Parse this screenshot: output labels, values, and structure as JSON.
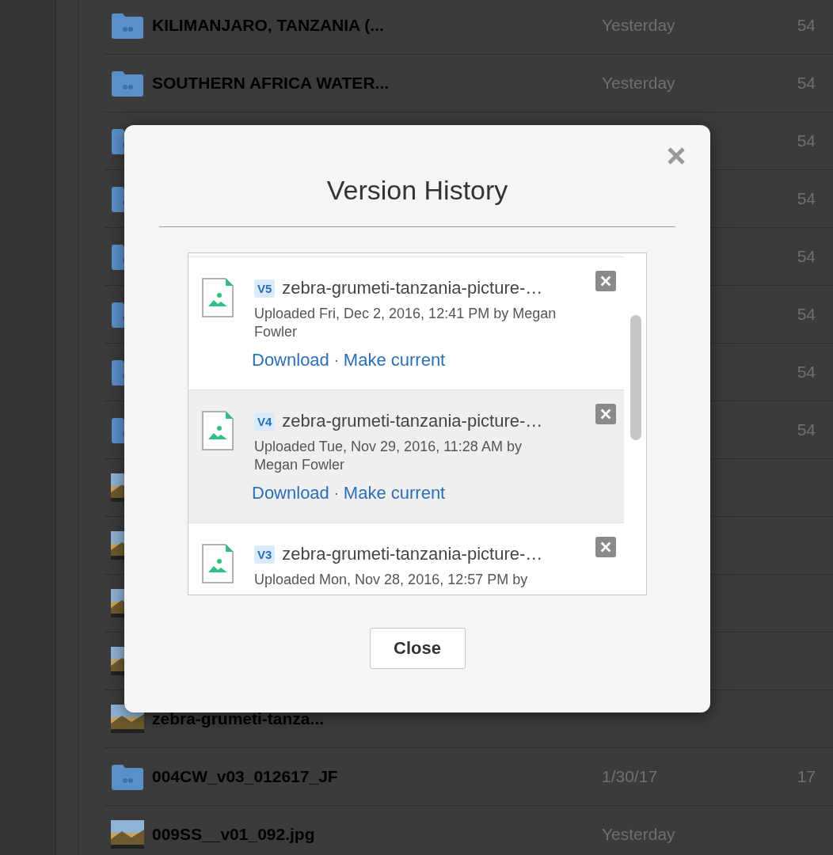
{
  "file_list": {
    "rows": [
      {
        "kind": "folder",
        "name": "KILIMANJARO, TANZANIA (...",
        "date": "Yesterday",
        "count": "54"
      },
      {
        "kind": "folder",
        "name": "SOUTHERN AFRICA WATER...",
        "date": "Yesterday",
        "count": "54"
      },
      {
        "kind": "folder",
        "count": "54"
      },
      {
        "kind": "folder",
        "count": "54"
      },
      {
        "kind": "folder",
        "count": "54"
      },
      {
        "kind": "folder",
        "count": "54"
      },
      {
        "kind": "folder",
        "count": "54"
      },
      {
        "kind": "folder",
        "count": "54"
      },
      {
        "kind": "picture"
      },
      {
        "kind": "picture"
      },
      {
        "kind": "picture"
      },
      {
        "kind": "picture"
      },
      {
        "kind": "picture",
        "name": "zebra-grumeti-tanza..."
      },
      {
        "kind": "folder",
        "name": "004CW_v03_012617_JF",
        "date": "1/30/17",
        "count": "17"
      },
      {
        "kind": "picture",
        "name": "009SS__v01_092.jpg",
        "date": "Yesterday"
      }
    ]
  },
  "dialog": {
    "title": "Version History",
    "versions": [
      {
        "badge": "V5",
        "name": "zebra-grumeti-tanzania-picture-…",
        "uploaded": "Uploaded Fri, Dec 2, 2016, 12:41 PM by Megan Fowler",
        "separator": "·",
        "actions": [
          "Download",
          "Make current"
        ],
        "highlighted": false
      },
      {
        "badge": "V4",
        "name": "zebra-grumeti-tanzania-picture-…",
        "uploaded": "Uploaded Tue, Nov 29, 2016, 11:28 AM by Megan Fowler",
        "separator": "·",
        "actions": [
          "Download",
          "Make current"
        ],
        "highlighted": true
      },
      {
        "badge": "V3",
        "name": "zebra-grumeti-tanzania-picture-…",
        "uploaded": "Uploaded Mon, Nov 28, 2016, 12:57 PM by",
        "highlighted": false
      }
    ],
    "button": "Close"
  }
}
